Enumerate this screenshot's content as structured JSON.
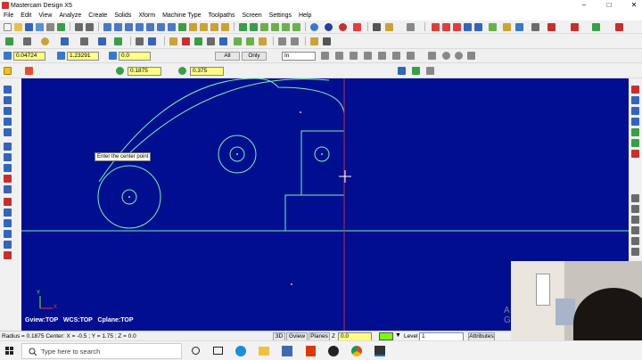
{
  "window": {
    "title": "Mastercam Design X5",
    "minimize": "–",
    "maximize": "□",
    "close": "✕"
  },
  "menu": [
    "File",
    "Edit",
    "View",
    "Analyze",
    "Create",
    "Solids",
    "Xform",
    "Machine Type",
    "Toolpaths",
    "Screen",
    "Settings",
    "Help"
  ],
  "ribbon": {
    "field1": "0.04724",
    "field2": "1.23291",
    "field3": "0.0",
    "all_label": "All",
    "only_label": "Only",
    "mode_value": "In",
    "radius_value": "0.1875",
    "diameter_value": "0.375"
  },
  "canvas": {
    "tooltip": "Enter the center point",
    "view_info": "Gview:TOP   WCS:TOP   Cplane:TOP",
    "axis_y": "Y",
    "axis_x": "X",
    "watermark": "A\nG"
  },
  "status": {
    "readout": "Radius = 0.1875 Center: X = -0.5 ; Y = 1.75 ; Z = 0.0",
    "btn_3d": "3D",
    "btn_gview": "Gview",
    "btn_planes": "Planes",
    "z_label": "Z",
    "z_value": "0.0",
    "level_label": "Level",
    "level_value": "1",
    "attributes_label": "Attributes"
  },
  "taskbar": {
    "search_placeholder": "Type here to search"
  },
  "colors": {
    "canvas_bg": "#000e8f",
    "geometry": "#7cf0b8",
    "crosshair": "#b33050",
    "highlight": "#7bff00",
    "field_bg": "#ffff80"
  },
  "icons": [
    "start-icon",
    "search-icon",
    "cortana-icon",
    "task-view-icon",
    "edge-icon",
    "file-explorer-icon",
    "store-icon",
    "office-icon",
    "chrome-icon",
    "mastercam-icon"
  ]
}
